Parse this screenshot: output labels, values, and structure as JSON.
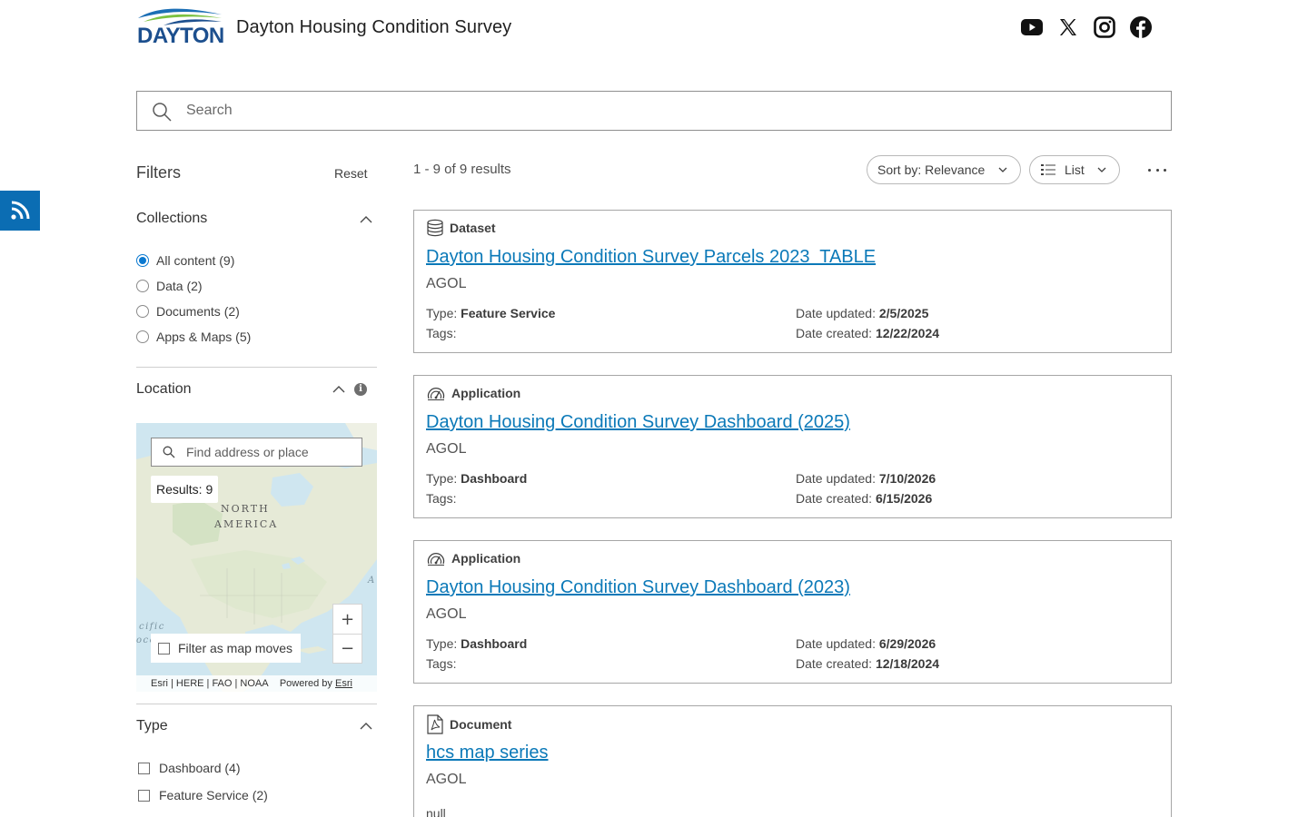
{
  "header": {
    "logo_text": "DAYTON",
    "site_title": "Dayton Housing Condition Survey",
    "socials": [
      "youtube-icon",
      "x-icon",
      "instagram-icon",
      "facebook-icon"
    ]
  },
  "search": {
    "placeholder": "Search",
    "value": ""
  },
  "filters": {
    "title": "Filters",
    "reset_label": "Reset",
    "collections": {
      "title": "Collections",
      "options": [
        {
          "label": "All content (9)",
          "selected": true
        },
        {
          "label": "Data (2)",
          "selected": false
        },
        {
          "label": "Documents (2)",
          "selected": false
        },
        {
          "label": "Apps & Maps (5)",
          "selected": false
        }
      ]
    },
    "location": {
      "title": "Location",
      "info_glyph": "i",
      "map_search_placeholder": "Find address or place",
      "results_badge": "Results: 9",
      "labels": [
        "NORTH",
        "AMERICA",
        "cific",
        "oce",
        "A"
      ],
      "zoom_in": "+",
      "zoom_out": "−",
      "filter_as_map_moves": "Filter as map moves",
      "attribution": "Esri | HERE | FAO | NOAA",
      "powered_by": "Powered by",
      "powered_by_link": "Esri"
    },
    "type": {
      "title": "Type",
      "options": [
        {
          "label": "Dashboard (4)",
          "checked": false
        },
        {
          "label": "Feature Service (2)",
          "checked": false
        }
      ]
    }
  },
  "results": {
    "count_text": "1 - 9 of 9 results",
    "sort_label": "Sort by: Relevance",
    "view_label": "List",
    "items": [
      {
        "kind": "Dataset",
        "icon": "database-icon",
        "title": "Dayton Housing Condition Survey Parcels 2023  TABLE",
        "owner": "AGOL",
        "type_label": "Type:",
        "type_value": "Feature Service",
        "tags_label": "Tags:",
        "updated_label": "Date updated:",
        "updated_value": "2/5/2025",
        "created_label": "Date created:",
        "created_value": "12/22/2024"
      },
      {
        "kind": "Application",
        "icon": "dashboard-gauge-icon",
        "title": "Dayton Housing Condition Survey Dashboard (2025)",
        "owner": "AGOL",
        "type_label": "Type:",
        "type_value": "Dashboard",
        "tags_label": "Tags:",
        "updated_label": "Date updated:",
        "updated_value": "7/10/2026",
        "created_label": "Date created:",
        "created_value": "6/15/2026"
      },
      {
        "kind": "Application",
        "icon": "dashboard-gauge-icon",
        "title": "Dayton Housing Condition Survey Dashboard (2023)",
        "owner": "AGOL",
        "type_label": "Type:",
        "type_value": "Dashboard",
        "tags_label": "Tags:",
        "updated_label": "Date updated:",
        "updated_value": "6/29/2026",
        "created_label": "Date created:",
        "created_value": "12/18/2024"
      },
      {
        "kind": "Document",
        "icon": "pdf-document-icon",
        "title": "hcs map series",
        "owner": "AGOL",
        "truncated_text": "null"
      }
    ]
  },
  "colors": {
    "accent": "#0b79d0",
    "link": "#0b79b8",
    "rss_tab": "#0b6db3",
    "logo_blue": "#1c4f8e",
    "logo_green": "#7cc242"
  }
}
